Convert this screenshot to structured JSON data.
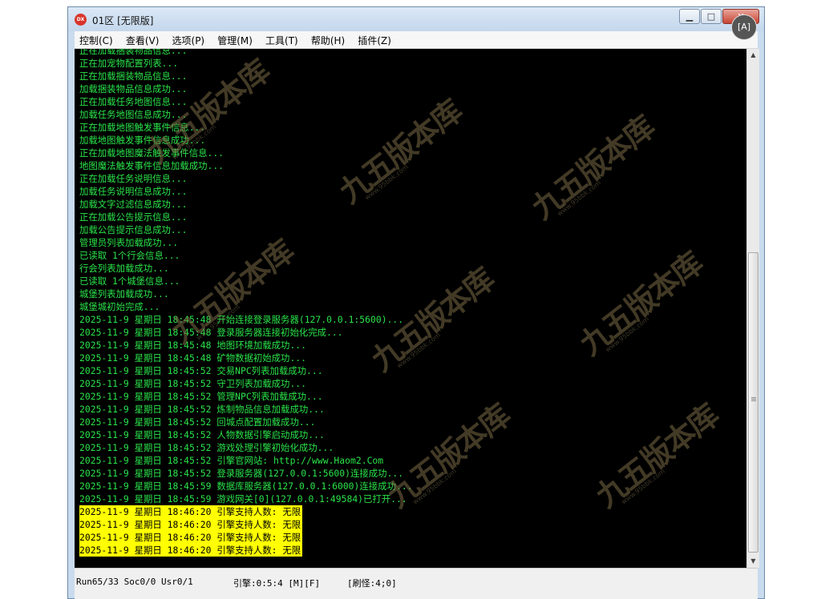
{
  "window": {
    "title": "01区 [无限版]",
    "icon_label": "DX",
    "controls": {
      "minimize": "▁",
      "maximize": "□",
      "close": "✕"
    }
  },
  "menu": [
    {
      "label": "控制(C)"
    },
    {
      "label": "查看(V)"
    },
    {
      "label": "选项(P)"
    },
    {
      "label": "管理(M)"
    },
    {
      "label": "工具(T)"
    },
    {
      "label": "帮助(H)"
    },
    {
      "label": "插件(Z)"
    }
  ],
  "console": {
    "lines": [
      {
        "text": "正在加载捆装物品信息..."
      },
      {
        "text": "正在加宠物配置列表..."
      },
      {
        "text": "正在加载捆装物品信息..."
      },
      {
        "text": "加载捆装物品信息成功..."
      },
      {
        "text": "正在加载任务地图信息..."
      },
      {
        "text": "加载任务地图信息成功..."
      },
      {
        "text": "正在加载地图触发事件信息..."
      },
      {
        "text": "加载地图触发事件信息成功..."
      },
      {
        "text": "正在加载地图魔法触发事件信息..."
      },
      {
        "text": "地图魔法触发事件信息加载成功..."
      },
      {
        "text": "正在加载任务说明信息..."
      },
      {
        "text": "加载任务说明信息成功..."
      },
      {
        "text": "加载文字过滤信息成功..."
      },
      {
        "text": "正在加载公告提示信息..."
      },
      {
        "text": "加载公告提示信息成功..."
      },
      {
        "text": "管理员列表加载成功..."
      },
      {
        "text": "已读取 1个行会信息..."
      },
      {
        "text": "行会列表加载成功..."
      },
      {
        "text": "已读取 1个城堡信息..."
      },
      {
        "text": "城堡列表加载成功..."
      },
      {
        "text": "城堡城初始完成..."
      },
      {
        "text": "2025-11-9 星期日 18:45:48 开始连接登录服务器(127.0.0.1:5600)..."
      },
      {
        "text": "2025-11-9 星期日 18:45:48 登录服务器连接初始化完成..."
      },
      {
        "text": "2025-11-9 星期日 18:45:48 地图环境加载成功..."
      },
      {
        "text": "2025-11-9 星期日 18:45:48 矿物数据初始成功..."
      },
      {
        "text": "2025-11-9 星期日 18:45:52 交易NPC列表加载成功..."
      },
      {
        "text": "2025-11-9 星期日 18:45:52 守卫列表加载成功..."
      },
      {
        "text": "2025-11-9 星期日 18:45:52 管理NPC列表加载成功..."
      },
      {
        "text": "2025-11-9 星期日 18:45:52 炼制物品信息加载成功..."
      },
      {
        "text": "2025-11-9 星期日 18:45:52 回城点配置加载成功..."
      },
      {
        "text": "2025-11-9 星期日 18:45:52 人物数据引擎启动成功..."
      },
      {
        "text": "2025-11-9 星期日 18:45:52 游戏处理引擎初始化成功..."
      },
      {
        "text": "2025-11-9 星期日 18:45:52 引擎官网站: http://www.Haom2.Com"
      },
      {
        "text": "2025-11-9 星期日 18:45:52 登录服务器(127.0.0.1:5600)连接成功..."
      },
      {
        "text": "2025-11-9 星期日 18:45:59 数据库服务器(127.0.0.1:6000)连接成功..."
      },
      {
        "text": "2025-11-9 星期日 18:45:59 游戏网关[0](127.0.0.1:49584)已打开..."
      },
      {
        "text": "2025-11-9 星期日 18:46:20 引擎支持人数: 无限",
        "highlight": true
      },
      {
        "text": "2025-11-9 星期日 18:46:20 引擎支持人数: 无限",
        "highlight": true
      },
      {
        "text": "2025-11-9 星期日 18:46:20 引擎支持人数: 无限",
        "highlight": true
      },
      {
        "text": "2025-11-9 星期日 18:46:20 引擎支持人数: 无限",
        "highlight": true
      }
    ]
  },
  "watermark": {
    "text": "九五版本库",
    "url": "www.95bbk.com"
  },
  "status": {
    "run": "Run65/33 Soc0/0 Usr0/1",
    "engine": "引擎:0:5:4 [M][F]",
    "refresh": "[刷怪:4;0]"
  },
  "translate_button": "[A]",
  "colors": {
    "console_bg": "#000000",
    "console_text": "#2ae34a",
    "highlight": "#ffff00"
  }
}
